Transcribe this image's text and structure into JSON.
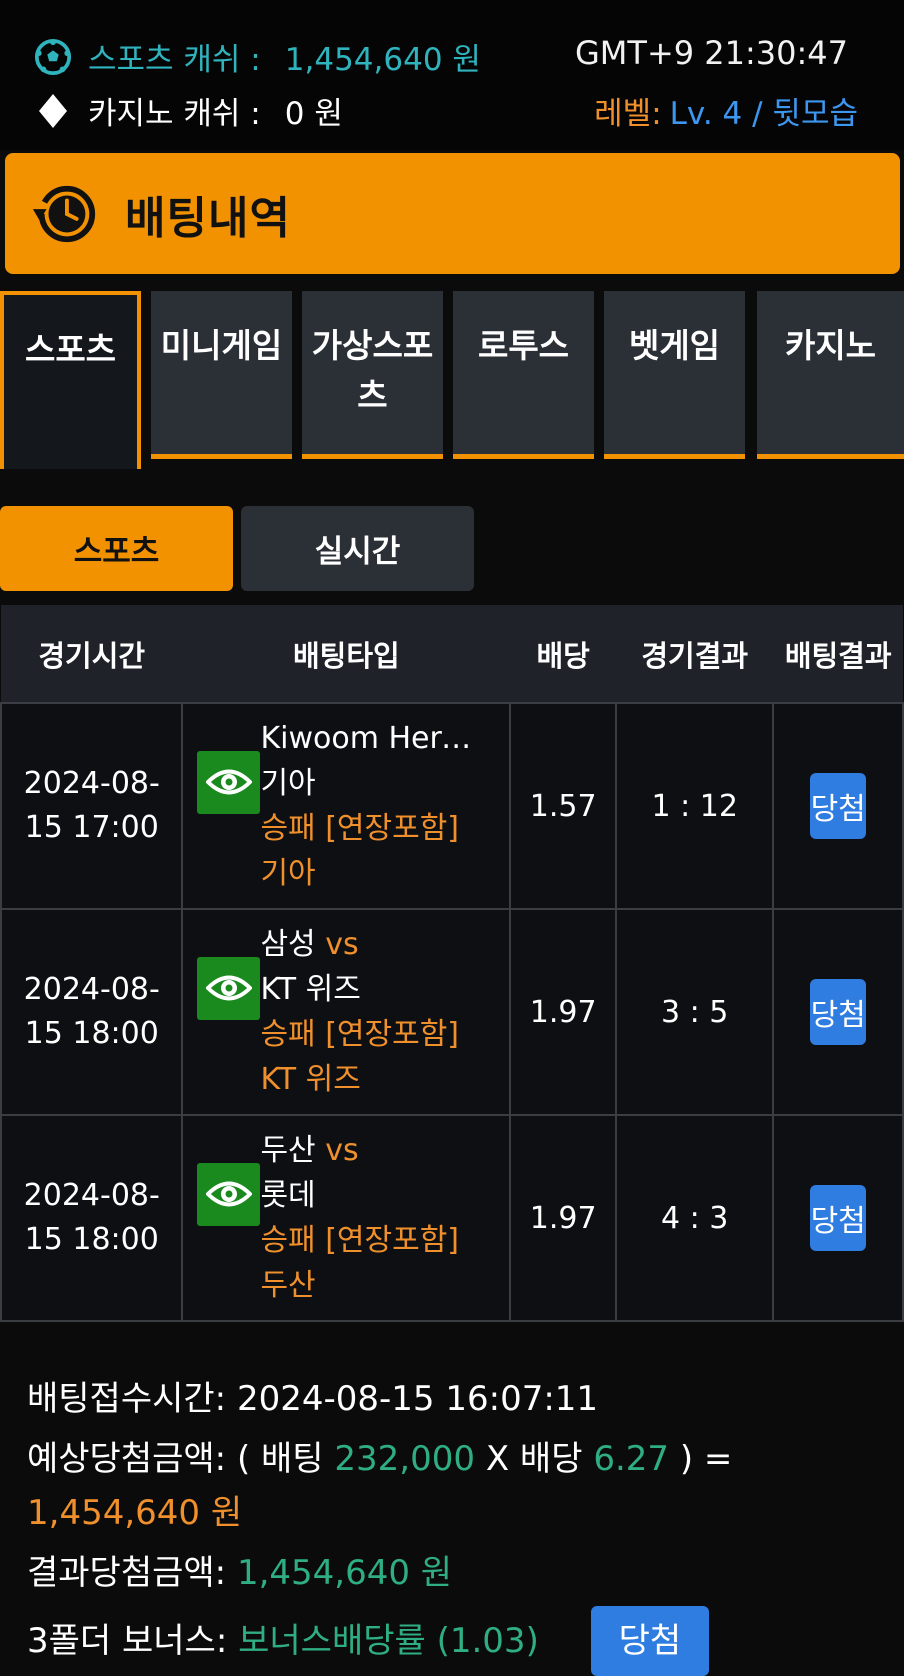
{
  "topbar": {
    "sports_cash_label": "스포츠 캐쉬 :",
    "sports_cash_value": "1,454,640 원",
    "casino_cash_label": "카지노 캐쉬 :",
    "casino_cash_value": "0 원",
    "clock": "GMT+9 21:30:47",
    "level_label": "레벨:",
    "level_value": "Lv. 4 / 뒷모습"
  },
  "page_title": "배팅내역",
  "category_tabs": [
    {
      "label": "스포츠",
      "active": true
    },
    {
      "label": "미니게임",
      "active": false
    },
    {
      "label": "가상스포츠",
      "active": false
    },
    {
      "label": "로투스",
      "active": false
    },
    {
      "label": "벳게임",
      "active": false
    },
    {
      "label": "카지노",
      "active": false
    }
  ],
  "category_tab_labels": {
    "t0": "스포츠",
    "t1": "미니게임",
    "t2a": "가상스포",
    "t2b": "츠",
    "t3": "로투스",
    "t4": "벳게임",
    "t5": "카지노"
  },
  "sub_tabs": {
    "sports": "스포츠",
    "live": "실시간"
  },
  "table": {
    "headers": {
      "time": "경기시간",
      "type": "배팅타입",
      "odds": "배당",
      "score": "경기결과",
      "result": "배팅결과"
    },
    "rows": [
      {
        "date": "2024-08-",
        "time": "15 17:00",
        "team1": "Kiwoom Hero...",
        "vs": "",
        "team2": "기아",
        "market": "승패 [연장포함]",
        "pick": "기아",
        "odds": "1.57",
        "score": "1 : 12",
        "result": "당첨"
      },
      {
        "date": "2024-08-",
        "time": "15 18:00",
        "team1": "삼성",
        "vs": "vs",
        "team2": "KT 위즈",
        "market": "승패 [연장포함]",
        "pick": "KT 위즈",
        "odds": "1.97",
        "score": "3 : 5",
        "result": "당첨"
      },
      {
        "date": "2024-08-",
        "time": "15 18:00",
        "team1": "두산",
        "vs": "vs",
        "team2": "롯데",
        "market": "승패 [연장포함]",
        "pick": "두산",
        "odds": "1.97",
        "score": "4 : 3",
        "result": "당첨"
      }
    ]
  },
  "summary": {
    "received_label": "배팅접수시간:",
    "received_value": "2024-08-15 16:07:11",
    "expected_label": "예상당첨금액:",
    "expected_open": "( 배팅",
    "stake": "232,000",
    "times": "X 배당",
    "total_odds": "6.27",
    "expected_close": ") =",
    "expected_amount": "1,454,640 원",
    "actual_label": "결과당첨금액:",
    "actual_amount": "1,454,640 원",
    "bonus_label": "3폴더 보너스:",
    "bonus_value": "보너스배당률 (1.03)",
    "bonus_badge": "당첨"
  },
  "colors": {
    "accent": "#f39200",
    "cyan": "#2fb3bd",
    "green": "#2fae84",
    "blue": "#2f7de1",
    "eye_green": "#1a8a1f"
  }
}
